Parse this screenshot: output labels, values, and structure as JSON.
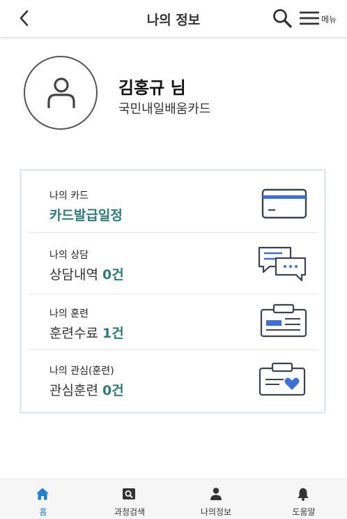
{
  "header": {
    "title": "나의 정보",
    "menu_label": "메뉴"
  },
  "profile": {
    "name": "김홍규 님",
    "program": "국민내일배움카드"
  },
  "cards": [
    {
      "label": "나의 카드",
      "value": "카드발급일정",
      "count": "",
      "icon": "credit-card-icon"
    },
    {
      "label": "나의 상담",
      "value": "상담내역 ",
      "count": "0건",
      "icon": "chat-bubbles-icon"
    },
    {
      "label": "나의 훈련",
      "value": "훈련수료 ",
      "count": "1건",
      "icon": "id-badge-icon"
    },
    {
      "label": "나의 관심(훈련)",
      "value": "관심훈련 ",
      "count": "0건",
      "icon": "heart-badge-icon"
    }
  ],
  "tabbar": {
    "items": [
      {
        "label": "홈",
        "icon": "home-icon",
        "active": true
      },
      {
        "label": "과정검색",
        "icon": "search-course-icon",
        "active": false
      },
      {
        "label": "나의정보",
        "icon": "person-icon",
        "active": false
      },
      {
        "label": "도움말",
        "icon": "bell-icon",
        "active": false
      }
    ]
  },
  "colors": {
    "accent": "#2e7b7b",
    "icon_blue": "#3d6fd6",
    "icon_stroke": "#3c4350",
    "tab_active": "#1f7fd6"
  }
}
